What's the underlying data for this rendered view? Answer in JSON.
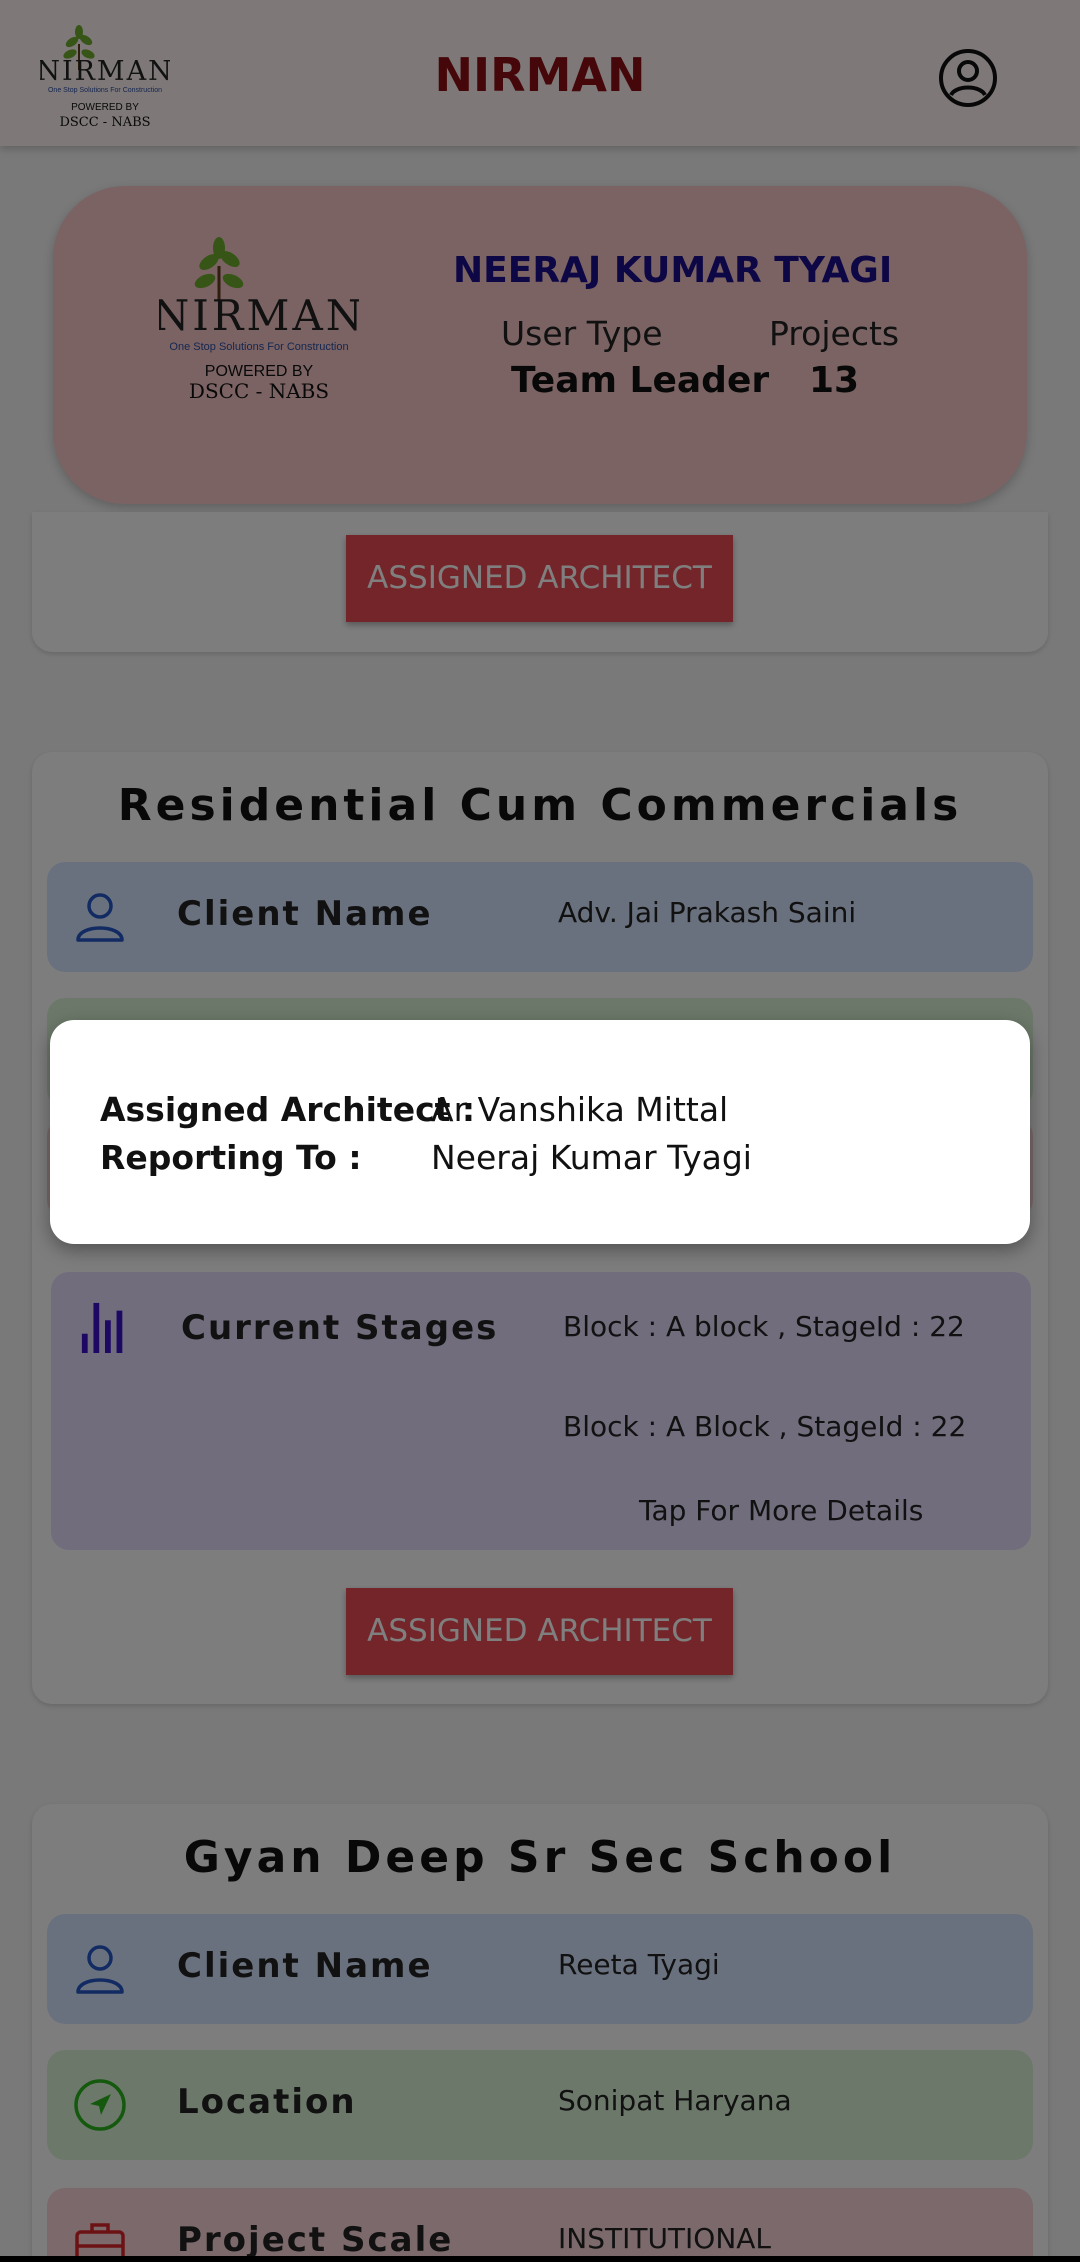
{
  "appbar": {
    "title": "NIRMAN",
    "logo_word": "NIRMAN",
    "logo_tagline": "One Stop Solutions For Construction",
    "logo_powered": "POWERED BY",
    "logo_company": "DSCC - NABS",
    "account_icon": "account-circle-icon"
  },
  "profile": {
    "name": "NEERAJ KUMAR TYAGI",
    "user_type_label": "User Type",
    "projects_label": "Projects",
    "user_type": "Team Leader",
    "projects": "13",
    "logo_word": "NIRMAN",
    "logo_tagline": "One Stop Solutions For Construction",
    "logo_powered": "POWERED BY",
    "logo_company": "DSCC - NABS"
  },
  "projects": [
    {
      "button_label": "ASSIGNED ARCHITECT"
    },
    {
      "title": "Residential Cum Commercials",
      "client_label": "Client Name",
      "client_value": "Adv. Jai Prakash Saini",
      "stages_label": "Current Stages",
      "stages": [
        "Block : A block , StageId : 22",
        "Block : A Block , StageId : 22"
      ],
      "tap_hint": "Tap For More Details",
      "button_label": "ASSIGNED ARCHITECT"
    },
    {
      "title": "Gyan Deep Sr Sec School",
      "client_label": "Client Name",
      "client_value": "Reeta Tyagi",
      "location_label": "Location",
      "location_value": "Sonipat Haryana",
      "scale_label": "Project Scale",
      "scale_value": "INSTITUTIONAL"
    }
  ],
  "dialog": {
    "architect_label": "Assigned Architect :",
    "architect_value": "Ar Vanshika Mittal",
    "reporting_label": "Reporting To :",
    "reporting_value": "Neeraj Kumar Tyagi"
  },
  "colors": {
    "brand_red": "#8b0f12",
    "button_red": "#e84a52",
    "name_blue": "#1a0e8c"
  }
}
